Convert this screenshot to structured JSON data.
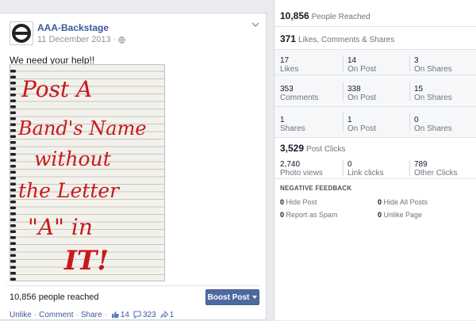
{
  "post": {
    "page_name": "AAA-Backstage",
    "date": "11 December 2013",
    "text": "We need your help!!",
    "photo_lines": [
      "Post A",
      "Band's Name",
      "without",
      "the Letter",
      "\"A\" in",
      "IT!"
    ],
    "reached": "10,856 people reached",
    "boost_label": "Boost Post",
    "actions": {
      "unlike": "Unlike",
      "comment": "Comment",
      "share": "Share"
    },
    "counts": {
      "likes": "14",
      "comments": "323",
      "shares": "1"
    }
  },
  "insights": {
    "people_reached": {
      "value": "10,856",
      "label": "People Reached"
    },
    "engagement": {
      "value": "371",
      "label": "Likes, Comments & Shares"
    },
    "likes": [
      {
        "value": "17",
        "label": "Likes"
      },
      {
        "value": "14",
        "label": "On Post"
      },
      {
        "value": "3",
        "label": "On Shares"
      }
    ],
    "comments": [
      {
        "value": "353",
        "label": "Comments"
      },
      {
        "value": "338",
        "label": "On Post"
      },
      {
        "value": "15",
        "label": "On Shares"
      }
    ],
    "shares": [
      {
        "value": "1",
        "label": "Shares"
      },
      {
        "value": "1",
        "label": "On Post"
      },
      {
        "value": "0",
        "label": "On Shares"
      }
    ],
    "post_clicks": {
      "value": "3,529",
      "label": "Post Clicks"
    },
    "clicks": [
      {
        "value": "2,740",
        "label": "Photo views"
      },
      {
        "value": "0",
        "label": "Link clicks"
      },
      {
        "value": "789",
        "label": "Other Clicks"
      }
    ],
    "negative": {
      "title": "NEGATIVE FEEDBACK",
      "items": [
        {
          "value": "0",
          "label": "Hide Post"
        },
        {
          "value": "0",
          "label": "Hide All Posts"
        },
        {
          "value": "0",
          "label": "Report as Spam"
        },
        {
          "value": "0",
          "label": "Unlike Page"
        }
      ]
    }
  },
  "colors": {
    "link": "#3b5998",
    "button": "#4e69a2",
    "marker": "#c8191e"
  }
}
